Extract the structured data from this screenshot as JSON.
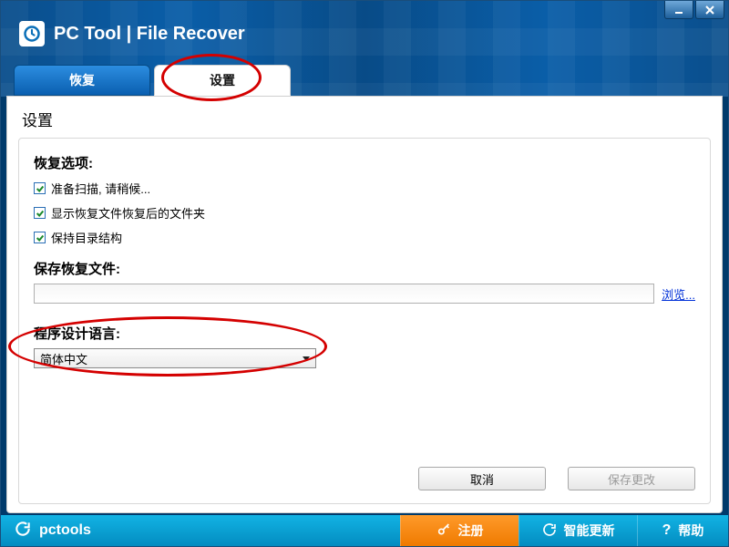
{
  "app": {
    "title": "PC Tool | File Recover",
    "brand": "pctools"
  },
  "tabs": {
    "recover": "恢复",
    "settings": "设置"
  },
  "page": {
    "heading": "设置"
  },
  "recovery_options": {
    "title": "恢复选项:",
    "opt1": "准备扫描, 请稍候...",
    "opt2": "显示恢复文件恢复后的文件夹",
    "opt3": "保持目录结构"
  },
  "save_files": {
    "title": "保存恢复文件:",
    "path": "",
    "browse": "浏览..."
  },
  "language": {
    "title": "程序设计语言:",
    "selected": "简体中文"
  },
  "buttons": {
    "cancel": "取消",
    "save_changes": "保存更改"
  },
  "bottombar": {
    "register": "注册",
    "smart_update": "智能更新",
    "help": "帮助"
  }
}
